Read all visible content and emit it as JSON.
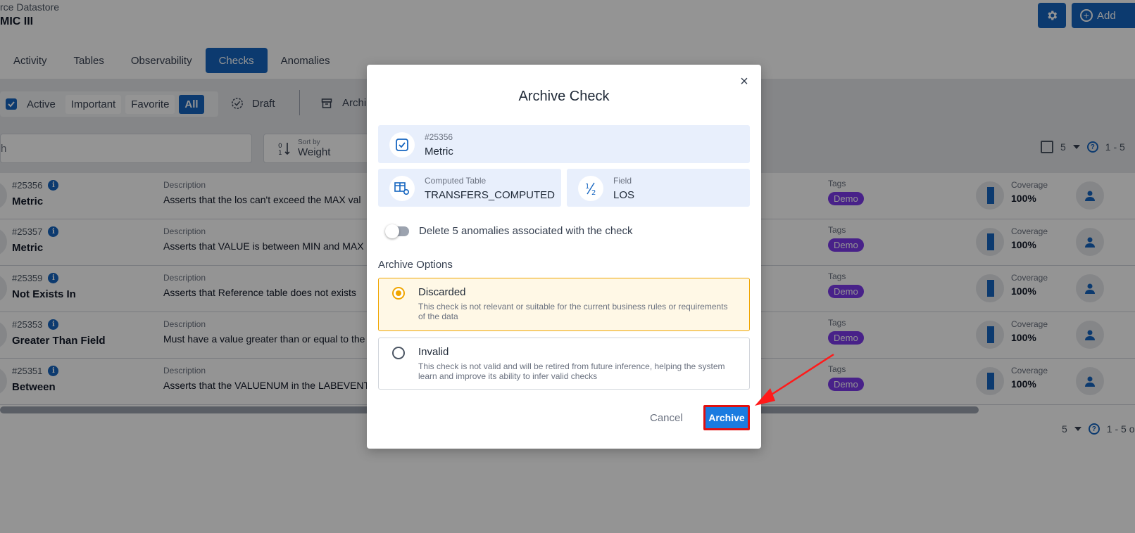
{
  "header": {
    "breadcrumb": "rce Datastore",
    "title": "MIC III",
    "settings_icon": "gear-icon",
    "add_label": "Add"
  },
  "tabs": [
    {
      "label": "Activity",
      "active": false
    },
    {
      "label": "Tables",
      "active": false
    },
    {
      "label": "Observability",
      "active": false
    },
    {
      "label": "Checks",
      "active": true
    },
    {
      "label": "Anomalies",
      "active": false
    }
  ],
  "filters": {
    "active": "Active",
    "important": "Important",
    "favorite": "Favorite",
    "all": "All",
    "draft": "Draft",
    "archived": "Archi"
  },
  "search": {
    "value": "h"
  },
  "sort": {
    "label": "Sort by",
    "value": "Weight"
  },
  "pager_top": {
    "page_size": "5",
    "range": "1 - 5"
  },
  "pager_bottom": {
    "page_size": "5",
    "range": "1 - 5 o"
  },
  "rows": [
    {
      "id": "#25356",
      "type": "Metric",
      "desc_label": "Description",
      "desc": "Asserts that the los can't exceed the MAX val",
      "tags_label": "Tags",
      "tag": "Demo",
      "coverage_label": "Coverage",
      "coverage": "100%"
    },
    {
      "id": "#25357",
      "type": "Metric",
      "desc_label": "Description",
      "desc": "Asserts that VALUE is between MIN and MAX",
      "tags_label": "Tags",
      "tag": "Demo",
      "coverage_label": "Coverage",
      "coverage": "100%"
    },
    {
      "id": "#25359",
      "type": "Not Exists In",
      "desc_label": "Description",
      "desc": "Asserts that Reference table does not exists",
      "tags_label": "Tags",
      "tag": "Demo",
      "coverage_label": "Coverage",
      "coverage": "100%"
    },
    {
      "id": "#25353",
      "type": "Greater Than Field",
      "desc_label": "Description",
      "desc": "Must have a value greater than or equal to the",
      "tags_label": "Tags",
      "tag": "Demo",
      "coverage_label": "Coverage",
      "coverage": "100%"
    },
    {
      "id": "#25351",
      "type": "Between",
      "desc_label": "Description",
      "desc": "Asserts that the VALUENUM in the LABEVENT",
      "tags_label": "Tags",
      "tag": "Demo",
      "coverage_label": "Coverage",
      "coverage": "100%"
    }
  ],
  "modal": {
    "title": "Archive Check",
    "check": {
      "id": "#25356",
      "type": "Metric"
    },
    "table": {
      "label": "Computed Table",
      "value": "TRANSFERS_COMPUTED"
    },
    "field": {
      "label": "Field",
      "value": "LOS"
    },
    "delete_toggle": {
      "label": "Delete 5 anomalies associated with the check",
      "on": false
    },
    "options_title": "Archive Options",
    "options": [
      {
        "name": "Discarded",
        "desc": "This check is not relevant or suitable for the current business rules or requirements of the data",
        "selected": true
      },
      {
        "name": "Invalid",
        "desc": "This check is not valid and will be retired from future inference, helping the system learn and improve its ability to infer valid checks",
        "selected": false
      }
    ],
    "cancel_label": "Cancel",
    "archive_label": "Archive"
  },
  "colors": {
    "primary": "#1565c0",
    "archive_button": "#1a7be0",
    "highlight": "#e01010",
    "selected_option": "#f0a500",
    "tag": "#7c3aed"
  }
}
